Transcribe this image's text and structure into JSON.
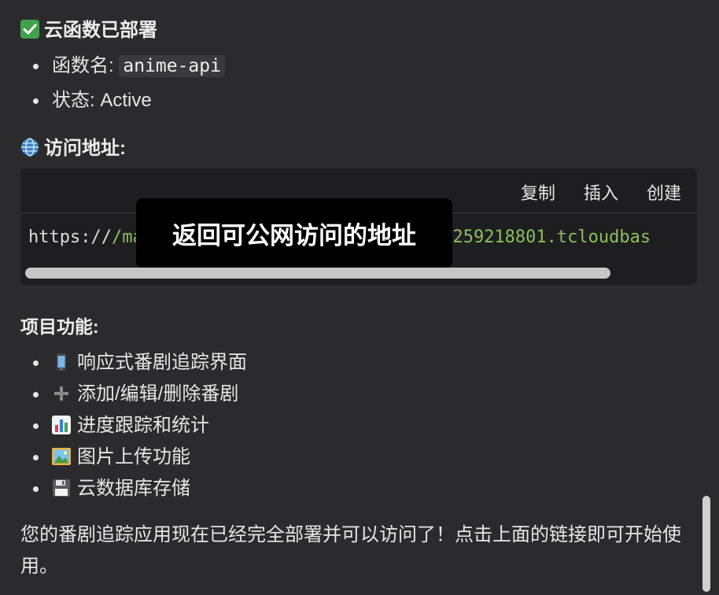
{
  "section1": {
    "heading": "云函数已部署",
    "icon": "check-mark-icon"
  },
  "function_name": {
    "label": "函数名:",
    "value": "anime-api"
  },
  "status": {
    "label": "状态: Active"
  },
  "section2": {
    "heading": "访问地址:",
    "icon": "globe-icon"
  },
  "codeblock": {
    "buttons": {
      "copy": "复制",
      "insert": "插入",
      "create": "创建"
    },
    "url_prefix": "https://",
    "url_visible_start": "/ma",
    "url_visible_end": "3-1259218801.tcloudbas"
  },
  "tooltip": {
    "text": "返回可公网访问的地址"
  },
  "features": {
    "heading": "项目功能:",
    "items": [
      {
        "icon": "mobile-phone-icon",
        "text": "响应式番剧追踪界面"
      },
      {
        "icon": "plus-icon",
        "text": "添加/编辑/删除番剧"
      },
      {
        "icon": "bar-chart-icon",
        "text": "进度跟踪和统计"
      },
      {
        "icon": "picture-icon",
        "text": "图片上传功能"
      },
      {
        "icon": "floppy-disk-icon",
        "text": "云数据库存储"
      }
    ]
  },
  "closing": {
    "text": "您的番剧追踪应用现在已经完全部署并可以访问了！点击上面的链接即可开始使用。"
  },
  "colors": {
    "background": "#2b2b2d",
    "code_bg": "#1e1e20",
    "url_green": "#8bbf5a",
    "check_green": "#3fa24a"
  }
}
